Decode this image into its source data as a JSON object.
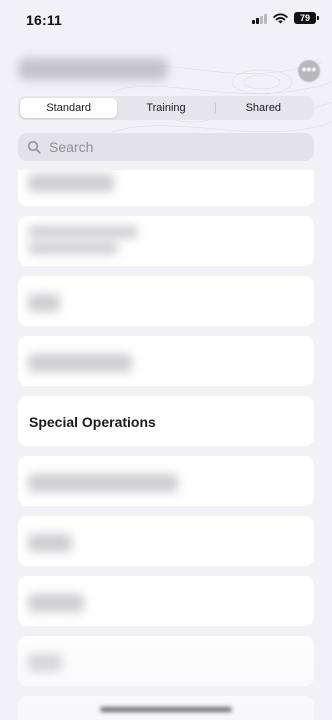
{
  "status_bar": {
    "time": "16:11",
    "battery": "79"
  },
  "nav": {
    "more_icon": "ellipsis-circle-icon"
  },
  "segments": [
    {
      "label": "Standard",
      "selected": true
    },
    {
      "label": "Training",
      "selected": false
    },
    {
      "label": "Shared",
      "selected": false
    }
  ],
  "search": {
    "placeholder": "Search",
    "icon": "magnifying-glass-icon"
  },
  "list": {
    "special_label": "Special Operations"
  },
  "colors": {
    "background": "#f1f1f6",
    "card": "#ffffff",
    "segment_track": "#e5e5ea",
    "search_field": "#e2e2e7"
  }
}
